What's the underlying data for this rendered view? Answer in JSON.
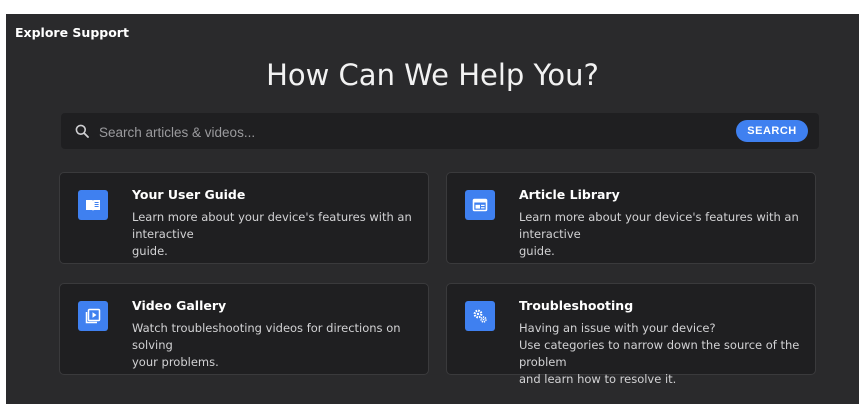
{
  "header": {
    "eyebrow": "Explore Support",
    "title": "How Can We Help You?"
  },
  "search": {
    "placeholder": "Search articles & videos...",
    "button_label": "SEARCH"
  },
  "colors": {
    "accent": "#3f80f0",
    "panel": "#2a2a2c",
    "card": "#1f1f21"
  },
  "cards": [
    {
      "icon": "book-icon",
      "title": "Your User Guide",
      "lines": [
        "Learn more about your device's features with an interactive",
        "guide."
      ]
    },
    {
      "icon": "browser-window-icon",
      "title": "Article Library",
      "lines": [
        "Learn more about your device's features with an interactive",
        "guide."
      ]
    },
    {
      "icon": "play-video-icon",
      "title": "Video Gallery",
      "lines": [
        "Watch troubleshooting videos for directions on solving",
        "your problems."
      ]
    },
    {
      "icon": "gears-icon",
      "title": "Troubleshooting",
      "lines": [
        "Having an issue with your device?",
        "Use categories to narrow down the source of the problem",
        "and learn how to resolve it."
      ]
    }
  ]
}
